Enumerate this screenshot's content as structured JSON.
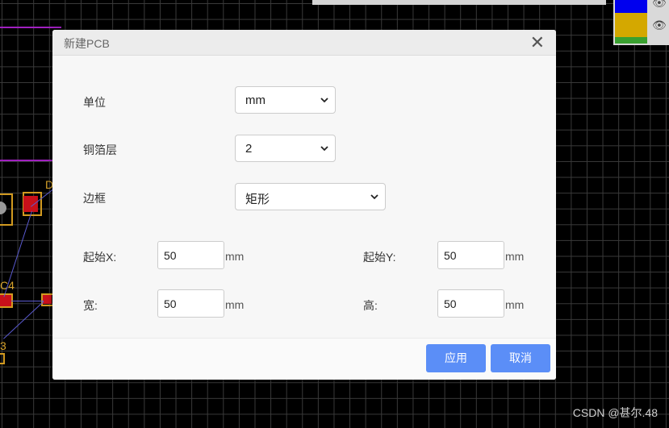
{
  "dialog": {
    "title": "新建PCB",
    "fields": {
      "unit": {
        "label": "单位",
        "value": "mm"
      },
      "copper_layers": {
        "label": "铜箔层",
        "value": "2"
      },
      "border": {
        "label": "边框",
        "value": "矩形"
      },
      "start_x": {
        "label": "起始X:",
        "value": "50",
        "unit": "mm"
      },
      "start_y": {
        "label": "起始Y:",
        "value": "50",
        "unit": "mm"
      },
      "width": {
        "label": "宽:",
        "value": "50",
        "unit": "mm"
      },
      "height": {
        "label": "高:",
        "value": "50",
        "unit": "mm"
      }
    },
    "buttons": {
      "apply": "应用",
      "cancel": "取消"
    }
  },
  "canvas": {
    "labels": [
      "D",
      "C4",
      "3"
    ],
    "colors": {
      "pad": "#c8101a",
      "silkscreen": "#d29a20",
      "board_outline": "#a020c0",
      "trace": "#5a5ad0"
    }
  },
  "layer_panel": {
    "swatches": [
      "#0000ee",
      "#d4a800",
      "#3aa030"
    ],
    "icon": "eye-icon"
  },
  "watermark": "CSDN @甚尔.48",
  "colors": {
    "primary_button": "#5b8ef7"
  }
}
